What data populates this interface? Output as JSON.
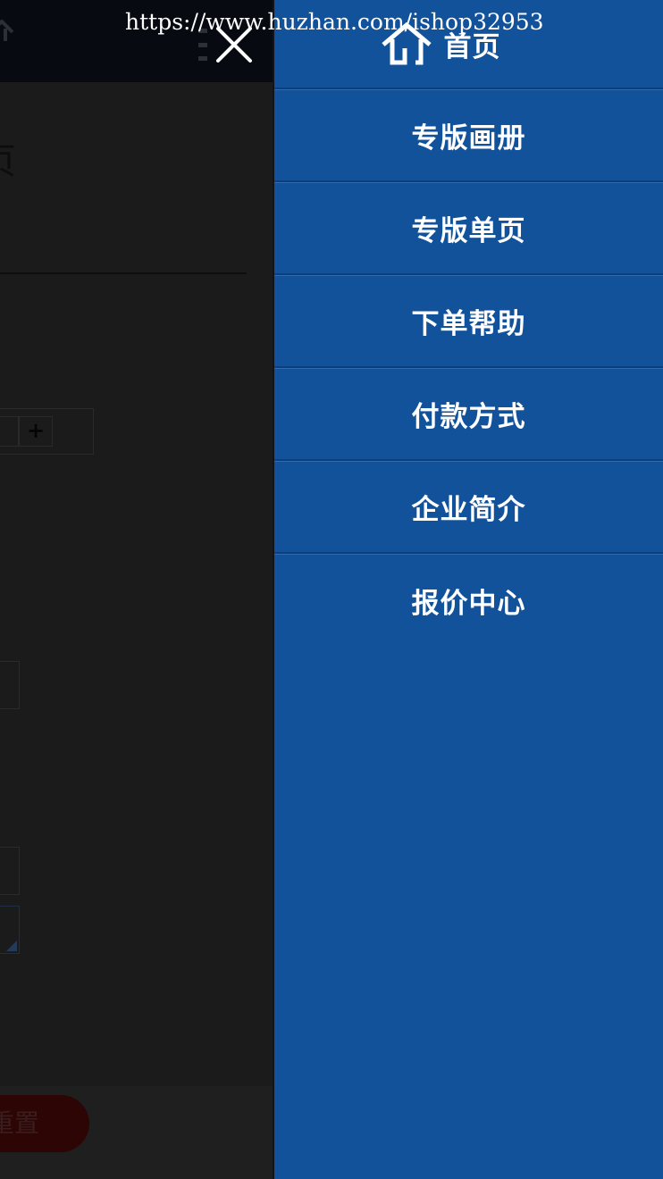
{
  "watermark": "https://www.huzhan.com/ishop32953",
  "page": {
    "title_fragment": "页",
    "stepper_plus": "+",
    "reset_label": "重置"
  },
  "nav": {
    "items": [
      {
        "label": "首页",
        "icon": "home-icon"
      },
      {
        "label": "专版画册"
      },
      {
        "label": "专版单页"
      },
      {
        "label": "下单帮助"
      },
      {
        "label": "付款方式"
      },
      {
        "label": "企业简介"
      },
      {
        "label": "报价中心"
      }
    ]
  },
  "colors": {
    "drawer_bg": "#12529b",
    "overlay_bg": "#1b1b1b",
    "text": "#ffffff"
  }
}
